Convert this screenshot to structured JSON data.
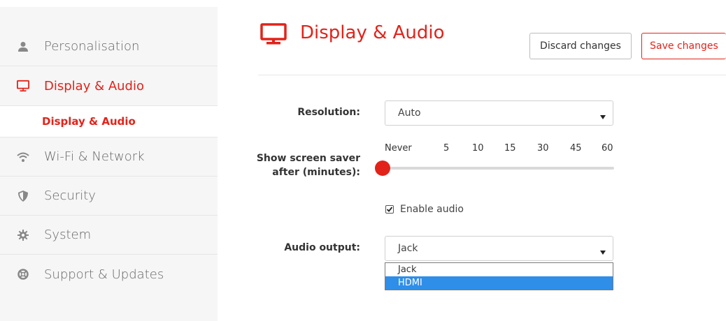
{
  "sidebar": {
    "items": [
      {
        "label": "Personalisation",
        "icon": "person-icon"
      },
      {
        "label": "Display & Audio",
        "icon": "monitor-icon",
        "active": true
      },
      {
        "label": "Wi-Fi & Network",
        "icon": "wifi-icon"
      },
      {
        "label": "Security",
        "icon": "shield-icon"
      },
      {
        "label": "System",
        "icon": "gear-icon"
      },
      {
        "label": "Support & Updates",
        "icon": "lifebuoy-icon"
      }
    ],
    "subitem": {
      "label": "Display & Audio"
    }
  },
  "header": {
    "title": "Display & Audio",
    "title_icon": "monitor-icon",
    "discard_label": "Discard changes",
    "save_label": "Save changes"
  },
  "form": {
    "resolution": {
      "label": "Resolution:",
      "value": "Auto"
    },
    "screensaver": {
      "label_line1": "Show screen saver",
      "label_line2": "after (minutes):",
      "ticks": [
        "Never",
        "5",
        "10",
        "15",
        "30",
        "45",
        "60"
      ],
      "selected": "Never"
    },
    "enable_audio": {
      "label": "Enable audio",
      "checked": true
    },
    "audio_output": {
      "label": "Audio output:",
      "value": "Jack",
      "options": [
        "Jack",
        "HDMI"
      ],
      "highlighted": "HDMI"
    }
  },
  "colors": {
    "accent": "#e2231a",
    "selection": "#2f8ee8",
    "sidebar_bg": "#f6f6f6"
  }
}
